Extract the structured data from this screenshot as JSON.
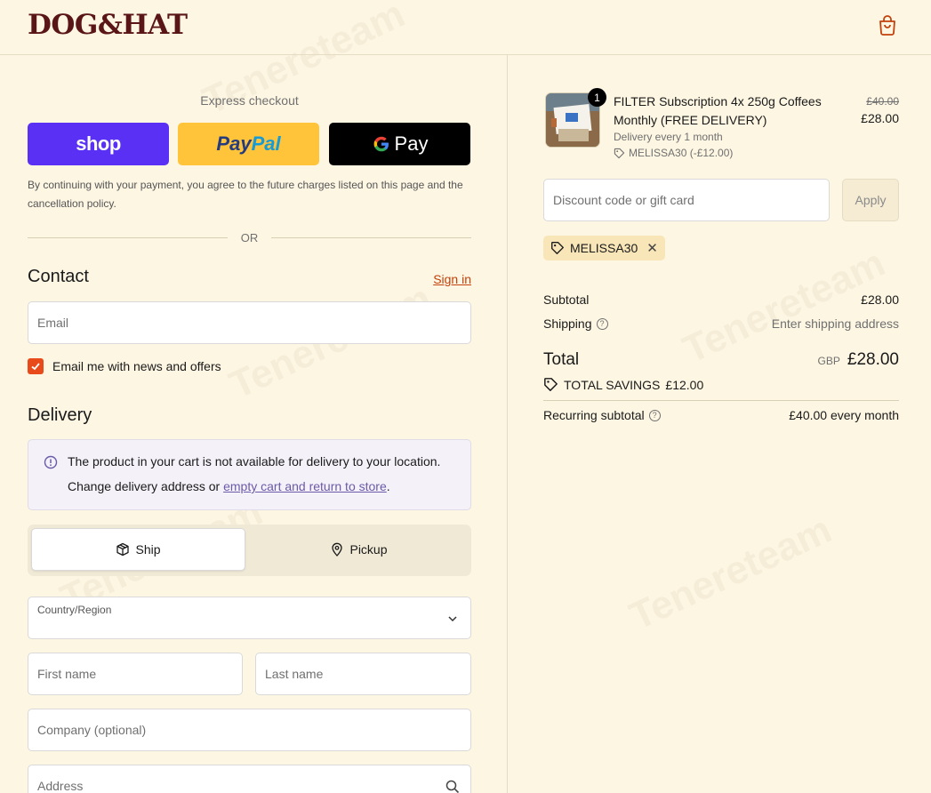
{
  "brand": {
    "logo_text": "DOG&HAT",
    "color": "#5a1616",
    "accent": "#e94a1b"
  },
  "header": {
    "cart_icon": "shopping-bag-icon"
  },
  "express": {
    "title": "Express checkout",
    "shop_label": "shop",
    "paypal_label_1": "Pay",
    "paypal_label_2": "Pal",
    "gpay_label": "Pay",
    "consent": "By continuing with your payment, you agree to the future charges listed on this page and the cancellation policy.",
    "or_label": "OR"
  },
  "contact": {
    "title": "Contact",
    "signin_label": "Sign in",
    "email_placeholder": "Email",
    "newsletter_label": "Email me with news and offers",
    "newsletter_checked": true
  },
  "delivery": {
    "title": "Delivery",
    "notice_line1": "The product in your cart is not available for delivery to your location.",
    "notice_line2_prefix": "Change delivery address or ",
    "notice_link": "empty cart and return to store",
    "notice_line2_suffix": ".",
    "ship_label": "Ship",
    "pickup_label": "Pickup",
    "country_label": "Country/Region",
    "first_name_placeholder": "First name",
    "last_name_placeholder": "Last name",
    "company_placeholder": "Company (optional)",
    "address_placeholder": "Address"
  },
  "cart": {
    "quantity": "1",
    "product_name": "FILTER Subscription 4x 250g Coffees Monthly (FREE DELIVERY)",
    "frequency": "Delivery every 1 month",
    "discount_applied": "MELISSA30 (-£12.00)",
    "old_price": "£40.00",
    "new_price": "£28.00"
  },
  "discount": {
    "placeholder": "Discount code or gift card",
    "apply_label": "Apply",
    "tag": "MELISSA30"
  },
  "summary": {
    "subtotal_label": "Subtotal",
    "subtotal_value": "£28.00",
    "shipping_label": "Shipping",
    "shipping_value": "Enter shipping address",
    "total_label": "Total",
    "total_currency": "GBP",
    "total_value": "£28.00",
    "savings_label": "TOTAL SAVINGS",
    "savings_value": "£12.00",
    "recurring_label": "Recurring subtotal",
    "recurring_value": "£40.00 every month"
  },
  "watermark": "Tenereteam"
}
